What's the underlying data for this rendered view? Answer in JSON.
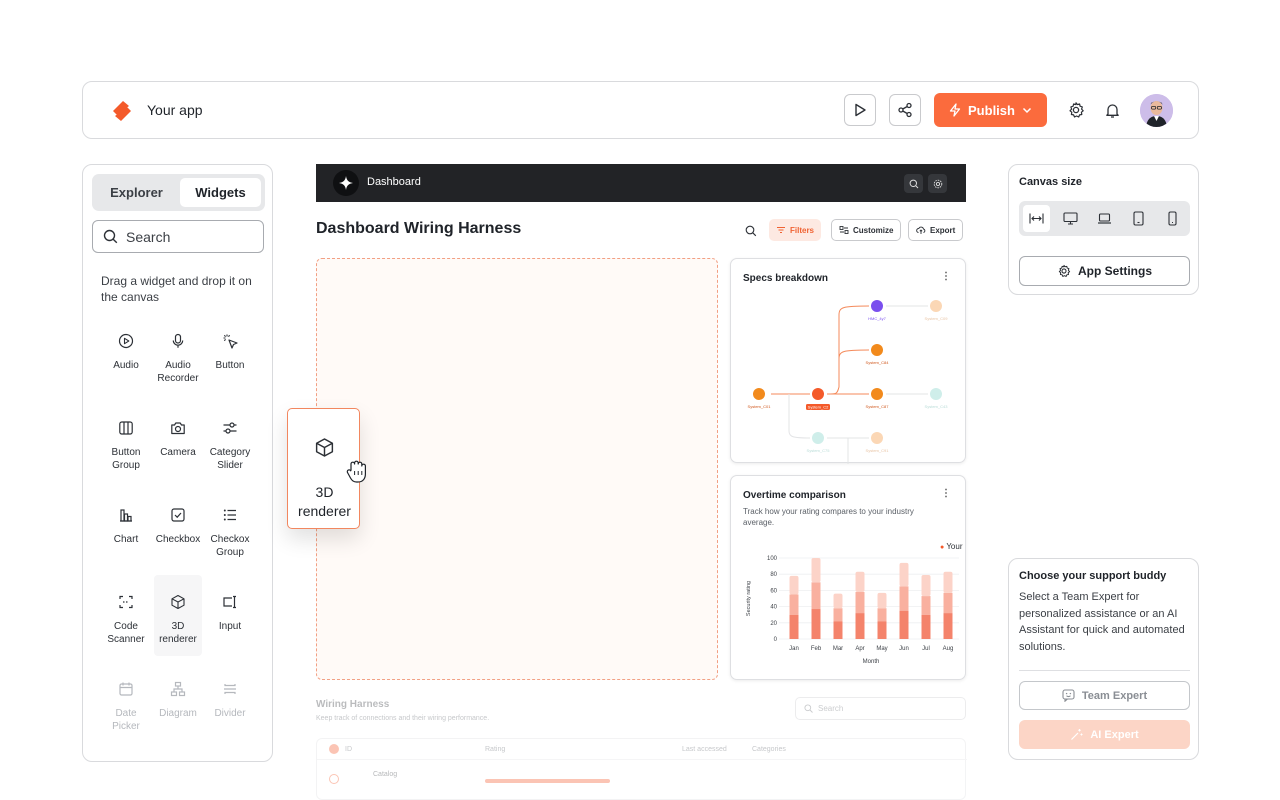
{
  "topbar": {
    "app_name": "Your app",
    "publish_label": "Publish",
    "icons": [
      "play-icon",
      "share-icon",
      "lightning-icon",
      "chevron-down-icon",
      "gear-icon",
      "bell-icon"
    ]
  },
  "left_panel": {
    "tabs": [
      {
        "label": "Explorer",
        "active": false
      },
      {
        "label": "Widgets",
        "active": true
      }
    ],
    "search_placeholder": "Search",
    "hint": "Drag a widget and drop it on the canvas",
    "widgets": [
      {
        "label": "Audio",
        "icon": "play-circle-icon"
      },
      {
        "label": "Audio Recorder",
        "icon": "microphone-icon"
      },
      {
        "label": "Button",
        "icon": "cursor-click-icon"
      },
      {
        "label": "Button Group",
        "icon": "columns-icon"
      },
      {
        "label": "Camera",
        "icon": "camera-icon"
      },
      {
        "label": "Category Slider",
        "icon": "slider-icon"
      },
      {
        "label": "Chart",
        "icon": "bar-chart-icon"
      },
      {
        "label": "Checkbox",
        "icon": "checkbox-icon"
      },
      {
        "label": "Checkox Group",
        "icon": "list-icon"
      },
      {
        "label": "Code Scanner",
        "icon": "scan-icon"
      },
      {
        "label": "3D renderer",
        "icon": "cube-icon"
      },
      {
        "label": "Input",
        "icon": "input-icon"
      },
      {
        "label": "Date Picker",
        "icon": "calendar-icon"
      },
      {
        "label": "Diagram",
        "icon": "hierarchy-icon"
      },
      {
        "label": "Divider",
        "icon": "divider-icon"
      }
    ]
  },
  "canvas": {
    "darkbar_title": "Dashboard",
    "page_title": "Dashboard Wiring Harness",
    "buttons": {
      "filters": "Filters",
      "customize": "Customize",
      "export": "Export"
    },
    "drag_tile_label": "3D renderer",
    "specs_card": {
      "title": "Specs breakdown",
      "nodes": [
        "System_C01",
        "System_C2",
        "HMC_4y7",
        "System_C84",
        "System_C87",
        "System_C09",
        "System_C43",
        "System_C75",
        "System_C91"
      ]
    },
    "overtime_card": {
      "title": "Overtime comparison",
      "subtitle": "Track how your rating compares to your industry average.",
      "legend": "Your"
    },
    "wiring": {
      "title": "Wiring Harness",
      "subtitle": "Keep track of connections and their wiring performance.",
      "search_placeholder": "Search",
      "columns": [
        "ID",
        "Rating",
        "Last accessed",
        "Categories"
      ],
      "row_name": "Catalog"
    }
  },
  "canvas_size": {
    "title": "Canvas size",
    "options": [
      "fit-width-icon",
      "desktop-icon",
      "laptop-icon",
      "tablet-icon",
      "phone-icon"
    ],
    "active_index": 0,
    "app_settings_label": "App Settings"
  },
  "support": {
    "title": "Choose your support buddy",
    "text": "Select a Team Expert for personalized assistance or an AI Assistant for quick and automated solutions.",
    "team_expert_label": "Team Expert",
    "ai_expert_label": "AI Expert"
  },
  "colors": {
    "accent": "#fb6b3d",
    "dark": "#222326",
    "accent_soft": "#fde9e2"
  },
  "chart_data": {
    "type": "bar",
    "title": "",
    "xlabel": "Month",
    "ylabel": "Security rating",
    "categories": [
      "Jan",
      "Feb",
      "Mar",
      "Apr",
      "May",
      "Jun",
      "Jul",
      "Aug"
    ],
    "yticks": [
      0,
      20,
      40,
      60,
      80,
      100
    ],
    "ylim": [
      0,
      100
    ],
    "stacked": true,
    "series": [
      {
        "name": "",
        "values": [
          30,
          37,
          22,
          32,
          22,
          35,
          30,
          32
        ]
      },
      {
        "name": "",
        "values": [
          25,
          33,
          16,
          26,
          16,
          30,
          23,
          25
        ]
      },
      {
        "name": "Your",
        "values": [
          23,
          30,
          18,
          25,
          19,
          29,
          26,
          26
        ]
      }
    ],
    "series_colors": [
      "#f4836b",
      "#f9b09f",
      "#fcd3c8"
    ],
    "legend_position": "top-right"
  }
}
